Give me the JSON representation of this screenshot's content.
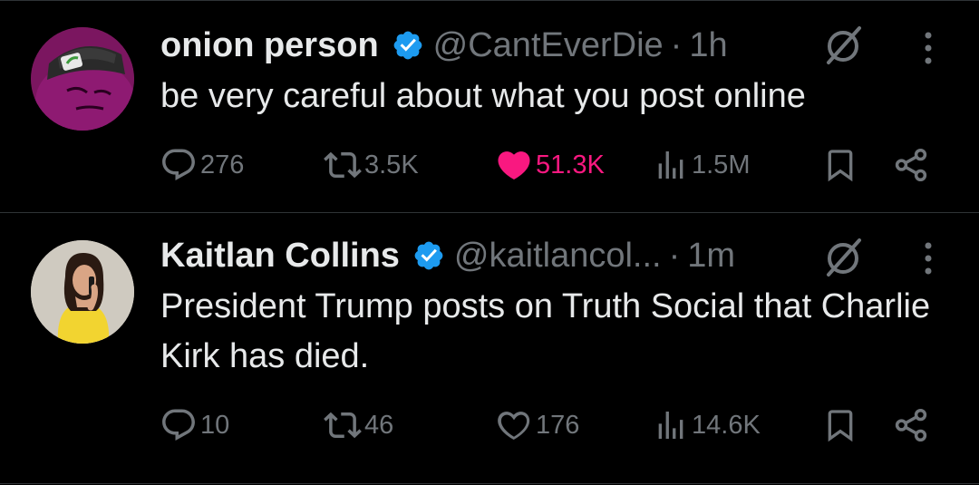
{
  "tweets": [
    {
      "name": "onion person",
      "handle": "@CantEverDie",
      "separator": "·",
      "time": "1h",
      "text": "be very careful about what you post online",
      "replies": "276",
      "retweets": "3.5K",
      "likes": "51.3K",
      "views": "1.5M",
      "liked": true
    },
    {
      "name": "Kaitlan Collins",
      "handle": "@kaitlancol...",
      "separator": "·",
      "time": "1m",
      "text": "President Trump posts on Truth Social that Charlie Kirk has died.",
      "replies": "10",
      "retweets": "46",
      "likes": "176",
      "views": "14.6K",
      "liked": false
    }
  ],
  "icons": {
    "reply": "reply-icon",
    "retweet": "retweet-icon",
    "like": "heart-icon",
    "views": "views-icon",
    "bookmark": "bookmark-icon",
    "share": "share-icon",
    "verified": "verified-badge-icon",
    "grok": "grok-icon",
    "more": "more-icon"
  },
  "colors": {
    "background": "#000000",
    "text_primary": "#e7e9ea",
    "text_secondary": "#71767b",
    "verified_blue": "#1d9bf0",
    "like_pink": "#f91880",
    "divider": "#2f3336"
  }
}
